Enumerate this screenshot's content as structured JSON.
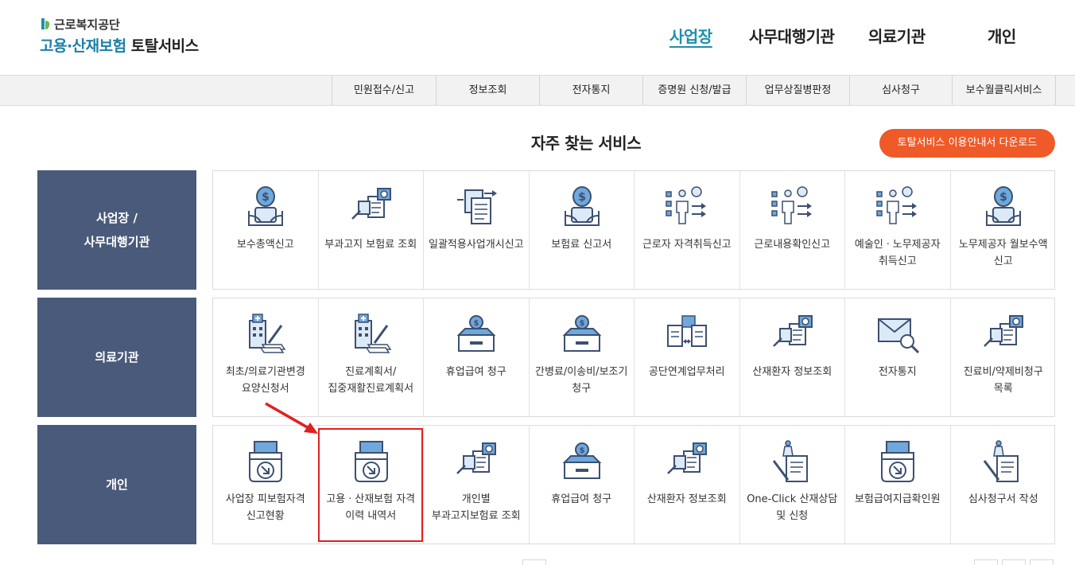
{
  "logo": {
    "top_text": "근로복지공단",
    "bottom_text_blue": "고용·산재보험",
    "bottom_text_dark": "토탈서비스"
  },
  "top_nav": {
    "items": [
      {
        "label": "사업장",
        "active": true
      },
      {
        "label": "사무대행기관",
        "active": false
      },
      {
        "label": "의료기관",
        "active": false
      },
      {
        "label": "개인",
        "active": false
      }
    ]
  },
  "sub_nav": {
    "items": [
      {
        "label": "민원접수/신고"
      },
      {
        "label": "정보조회"
      },
      {
        "label": "전자통지"
      },
      {
        "label": "증명원 신청/발급"
      },
      {
        "label": "업무상질병판정"
      },
      {
        "label": "심사청구"
      },
      {
        "label": "보수월클릭서비스"
      }
    ]
  },
  "section": {
    "title": "자주 찾는 서비스",
    "download_label": "토탈서비스 이용안내서 다운로드"
  },
  "rows": [
    {
      "label": "사업장 /\n사무대행기관",
      "items": [
        {
          "label": "보수총액신고",
          "icon": "money-hand-icon"
        },
        {
          "label": "부과고지 보험료 조회",
          "icon": "document-search-icon"
        },
        {
          "label": "일괄적용사업개시신고",
          "icon": "document-transfer-icon"
        },
        {
          "label": "보험료 신고서",
          "icon": "money-hand-icon"
        },
        {
          "label": "근로자 자격취득신고",
          "icon": "person-list-icon"
        },
        {
          "label": "근로내용확인신고",
          "icon": "person-list-icon"
        },
        {
          "label": "예술인ㆍ노무제공자 취득신고",
          "icon": "person-list-icon"
        },
        {
          "label": "노무제공자 월보수액 신고",
          "icon": "money-hand-icon"
        }
      ]
    },
    {
      "label": "의료기관",
      "items": [
        {
          "label": "최초/의료기관변경 요양신청서",
          "icon": "hospital-pen-icon"
        },
        {
          "label": "진료계획서/집중재활진료계획서",
          "icon": "hospital-pen-icon"
        },
        {
          "label": "휴업급여 청구",
          "icon": "coin-box-icon"
        },
        {
          "label": "간병료/이송비/보조기 청구",
          "icon": "coin-box-icon"
        },
        {
          "label": "공단연계업무처리",
          "icon": "document-exchange-icon"
        },
        {
          "label": "산재환자 정보조회",
          "icon": "document-search-icon"
        },
        {
          "label": "전자통지",
          "icon": "mail-search-icon"
        },
        {
          "label": "진료비/약제비청구 목록",
          "icon": "document-search-icon"
        }
      ]
    },
    {
      "label": "개인",
      "items": [
        {
          "label": "사업장 피보험자격 신고현황",
          "icon": "printer-download-icon"
        },
        {
          "label": "고용ㆍ산재보험 자격 이력 내역서",
          "icon": "printer-download-icon"
        },
        {
          "label": "개인별 부과고지보험료 조회",
          "icon": "document-search-icon"
        },
        {
          "label": "휴업급여 청구",
          "icon": "coin-box-icon"
        },
        {
          "label": "산재환자 정보조회",
          "icon": "document-search-icon"
        },
        {
          "label": "One-Click 산재상담 및 신청",
          "icon": "document-pen-icon"
        },
        {
          "label": "보험급여지급확인원",
          "icon": "printer-download-icon"
        },
        {
          "label": "심사청구서 작성",
          "icon": "document-pen-icon"
        }
      ]
    }
  ],
  "colors": {
    "accent_blue": "#1c8fb0",
    "row_label_bg": "#4a5a7a",
    "download_bg": "#f05a28",
    "highlight": "#e02020"
  }
}
